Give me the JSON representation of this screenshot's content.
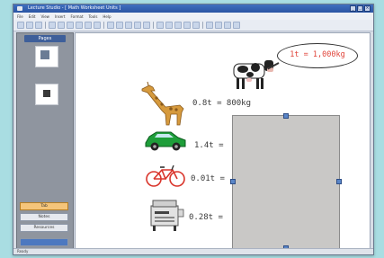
{
  "window": {
    "title": "Lecture Studio - [ Math Worksheet Units ]",
    "controls": [
      "_",
      "□",
      "×"
    ]
  },
  "menu": [
    "File",
    "Edit",
    "View",
    "Insert",
    "Format",
    "Tools",
    "Help"
  ],
  "sidebar": {
    "tab_label": "Pages",
    "buttons": [
      {
        "label": "Tab"
      },
      {
        "label": "Notes"
      },
      {
        "label": "Resources"
      },
      {
        "label": ""
      }
    ]
  },
  "canvas": {
    "bubble_text": "1t = 1,000kg",
    "rows": [
      {
        "item": "giraffe",
        "value": "0.8t = 800kg"
      },
      {
        "item": "car",
        "value": "1.4t ="
      },
      {
        "item": "bicycle",
        "value": "0.01t ="
      },
      {
        "item": "copier",
        "value": "0.28t ="
      }
    ]
  },
  "status": {
    "text": "Ready"
  },
  "colors": {
    "title_bar": "#2b55a3",
    "bubble_text": "#e0443a",
    "car": "#1e9e3a",
    "bicycle": "#d9342b",
    "giraffe": "#d69a3d",
    "overlay_panel": "#c9c8c6"
  }
}
